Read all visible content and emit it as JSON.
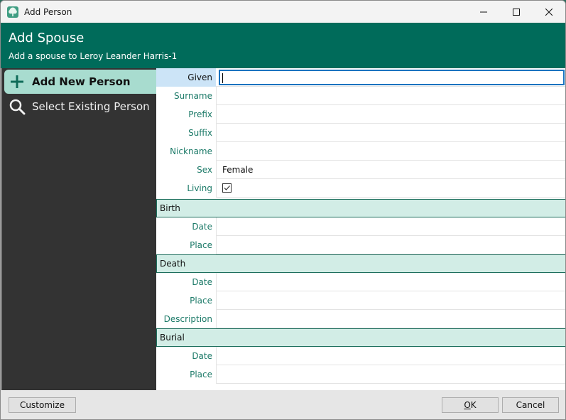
{
  "window": {
    "title": "Add Person",
    "controls": [
      "minimize",
      "maximize",
      "close"
    ]
  },
  "header": {
    "title": "Add Spouse",
    "subtitle": "Add a spouse to Leroy Leander Harris-1"
  },
  "sidebar": {
    "items": [
      {
        "label": "Add New Person",
        "icon": "plus-icon",
        "active": true
      },
      {
        "label": "Select Existing Person",
        "icon": "search-icon",
        "active": false
      }
    ]
  },
  "form": {
    "fields": [
      {
        "label": "Given",
        "value": "",
        "focused": true
      },
      {
        "label": "Surname",
        "value": ""
      },
      {
        "label": "Prefix",
        "value": ""
      },
      {
        "label": "Suffix",
        "value": ""
      },
      {
        "label": "Nickname",
        "value": ""
      },
      {
        "label": "Sex",
        "value": "Female"
      },
      {
        "label": "Living",
        "value": "",
        "checked": true
      }
    ],
    "birth": {
      "section": "Birth",
      "fields": [
        {
          "label": "Date",
          "value": ""
        },
        {
          "label": "Place",
          "value": ""
        }
      ]
    },
    "death": {
      "section": "Death",
      "fields": [
        {
          "label": "Date",
          "value": ""
        },
        {
          "label": "Place",
          "value": ""
        },
        {
          "label": "Description",
          "value": ""
        }
      ]
    },
    "burial": {
      "section": "Burial",
      "fields": [
        {
          "label": "Date",
          "value": ""
        },
        {
          "label": "Place",
          "value": ""
        }
      ]
    }
  },
  "footer": {
    "customize_label": "Customize",
    "ok_label": "OK",
    "ok_mnemonic": "O",
    "ok_rest": "K",
    "cancel_label": "Cancel"
  },
  "colors": {
    "header_bg": "#006b5a",
    "sidebar_bg": "#333333",
    "sidebar_active": "#a8dccf",
    "label_text": "#1c7a68",
    "section_bg": "#d2ede6",
    "focus_border": "#1a73c0"
  }
}
